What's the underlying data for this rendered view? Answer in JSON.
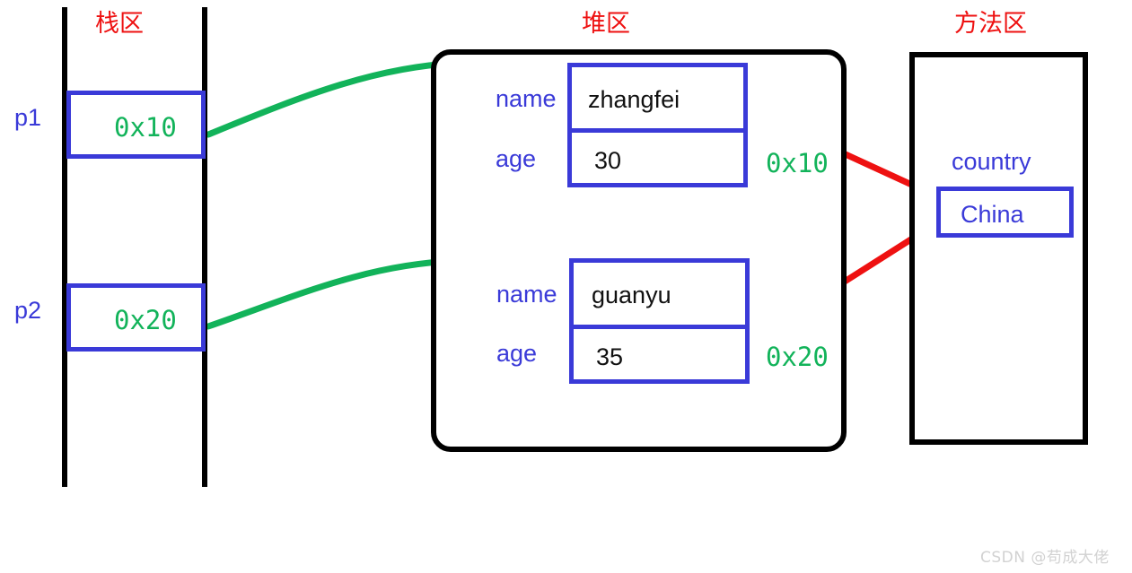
{
  "diagram": {
    "title_stack": "栈区",
    "title_heap": "堆区",
    "title_method": "方法区",
    "colors": {
      "region_title": "#ee1111",
      "blue": "#3a3ad8",
      "green": "#12b35a",
      "red": "#ee1111",
      "black": "#000000"
    }
  },
  "stack": {
    "frames": [
      {
        "name": "p1",
        "value": "0x10"
      },
      {
        "name": "p2",
        "value": "0x20"
      }
    ]
  },
  "heap": {
    "objects": [
      {
        "address": "0x10",
        "fields": [
          {
            "label": "name",
            "value": "zhangfei"
          },
          {
            "label": "age",
            "value": "30"
          }
        ]
      },
      {
        "address": "0x20",
        "fields": [
          {
            "label": "name",
            "value": "guanyu"
          },
          {
            "label": "age",
            "value": "35"
          }
        ]
      }
    ]
  },
  "method_area": {
    "field_label": "country",
    "field_value": "China"
  },
  "watermark": {
    "text": "CSDN @苟成大佬"
  }
}
